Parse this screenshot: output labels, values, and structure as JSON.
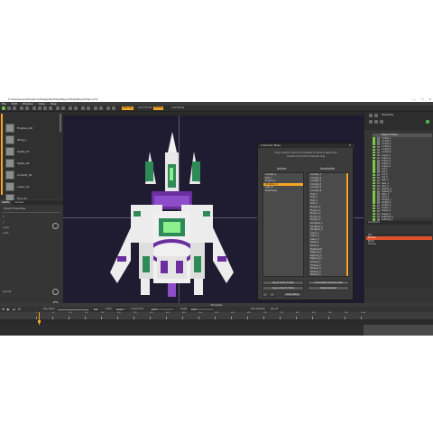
{
  "window": {
    "title": "C:\\Users\\user\\Dropbox\\Sheep\\Spritely\\Player\\Ship\\PlayerShip.scml",
    "app": "Spriter Pro Beta",
    "controls": [
      "—",
      "☐",
      "✕"
    ]
  },
  "menu": [
    "File",
    "Edit",
    "Window",
    "View",
    "Help"
  ],
  "toolbar": {
    "orange_buttons": [
      "Auto key",
      "Edit Kd"
    ],
    "labels": [
      "Lock Frames",
      "Lock Bones",
      "Lock Sprites"
    ]
  },
  "thumbnails": [
    "Engines_00",
    "Wing_L",
    "Spike_01",
    "Spike_02",
    "Cockpit_01",
    "Laser_01",
    "Hull_01"
  ],
  "left_tabs": [
    "Palette",
    "Canvas"
  ],
  "properties": {
    "title": "Object Properties",
    "rows": [
      "x",
      "y",
      "angle",
      "scale",
      "opacity",
      "pivot"
    ]
  },
  "dialog": {
    "title": "Character Maps",
    "help": [
      "Drag character maps from Available To Active to apply them.",
      "Double click to edit a character map."
    ],
    "active_header": "Active",
    "available_header": "Available",
    "active_items": [
      "Cockpit_1",
      "Hull_2",
      "Engine_4",
      "Wingtips_2",
      "Laser_1",
      "Bulkheads"
    ],
    "active_selected_index": 3,
    "available_items": [
      "Cockpit_1",
      "Cockpit_2",
      "Cockpit_3",
      "Cockpit_4",
      "Cockpit_5",
      "Cockpit_6",
      "Hull_1",
      "Hull_2",
      "Hull_3",
      "Hull_4",
      "Engine_1",
      "Engine_2",
      "Engine_3",
      "Engine_4",
      "Engine_5",
      "Wingtips_1",
      "Wingtips_2",
      "Wingtips_3",
      "Laser_1",
      "Laser_2",
      "Laser_3",
      "Spike_1",
      "Spike_2",
      "Bulkheads",
      "Bigwing_1",
      "Bigwing_2",
      "Bigwing_3",
      "Stripes_1",
      "Stripes_2",
      "Stripes_3",
      "Stripes_4",
      "Stripes_5"
    ],
    "buttons": [
      "Merge Active To New",
      "Create New Character Map",
      "Save Active To Entity",
      "Delete Selected",
      "Clear Active"
    ]
  },
  "right_panel": {
    "entity": "PlayerShip",
    "header": "Object Folders",
    "layers": [
      "cockpit_1",
      "cockpit_2",
      "cockpit_3",
      "cockpit_4",
      "cockpit_5",
      "cockpit_6",
      "engine_1",
      "engine_2",
      "engine_3",
      "engine_4",
      "engine_5",
      "hull_1",
      "hull_2",
      "hull_3",
      "hull_4",
      "laser_1",
      "laser_2",
      "laser_3",
      "bigwing_1",
      "bigwing_2",
      "spike_1",
      "spike_2",
      "wingtip_1",
      "wingtip_2",
      "wingtip_3",
      "stripes_1",
      "stripes_2",
      "stripes_3",
      "bulkhead_1",
      "bulkhead_2"
    ],
    "animations_title": "Animations",
    "animations": [
      "Idle",
      "Normal",
      "Boost",
      "Turning"
    ],
    "selected_animation": "Normal",
    "bottom_tabs": [
      "History",
      "Animations"
    ]
  },
  "timeline": {
    "title": "Timeline",
    "speed_label": "play speed",
    "fields": [
      "100",
      "Interp",
      "Linear",
      "current time",
      "2479",
      "length",
      "1000",
      "auto optimize",
      "play all"
    ],
    "ruler": [
      "0",
      "50",
      "100",
      "150",
      "200",
      "250",
      "300",
      "350",
      "400",
      "450",
      "500",
      "550",
      "600",
      "650",
      "700",
      "750",
      "800",
      "850",
      "900",
      "950",
      "1000"
    ]
  },
  "colors": {
    "accent": "#f5a623",
    "viewport": "#1f1b30",
    "ship_green": "#2e8b57",
    "ship_purple": "#6b2e9e",
    "ship_lime": "#8cf08c"
  }
}
